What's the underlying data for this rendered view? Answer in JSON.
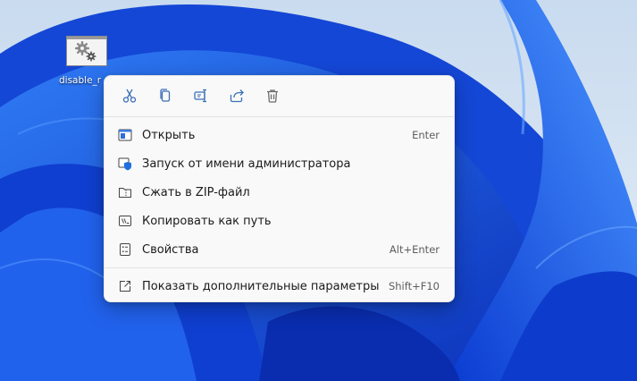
{
  "desktop": {
    "icon_label": "disable_r",
    "colors": {
      "wallpaper_base": "#1a4fd8",
      "wallpaper_light": "#d7e5f3",
      "accent": "#0067c0"
    }
  },
  "context_menu": {
    "quick_actions": [
      {
        "icon": "cut-icon",
        "name": "cut"
      },
      {
        "icon": "copy-icon",
        "name": "copy"
      },
      {
        "icon": "rename-icon",
        "name": "rename"
      },
      {
        "icon": "share-icon",
        "name": "share"
      },
      {
        "icon": "delete-icon",
        "name": "delete"
      }
    ],
    "items": [
      {
        "label": "Открыть",
        "shortcut": "Enter",
        "icon": "open-icon"
      },
      {
        "label": "Запуск от имени администратора",
        "shortcut": "",
        "icon": "admin-shield-icon"
      },
      {
        "label": "Сжать в ZIP-файл",
        "shortcut": "",
        "icon": "zip-folder-icon"
      },
      {
        "label": "Копировать как путь",
        "shortcut": "",
        "icon": "copy-path-icon"
      },
      {
        "label": "Свойства",
        "shortcut": "Alt+Enter",
        "icon": "properties-icon"
      },
      {
        "label": "Показать дополнительные параметры",
        "shortcut": "Shift+F10",
        "icon": "more-options-icon"
      }
    ]
  }
}
